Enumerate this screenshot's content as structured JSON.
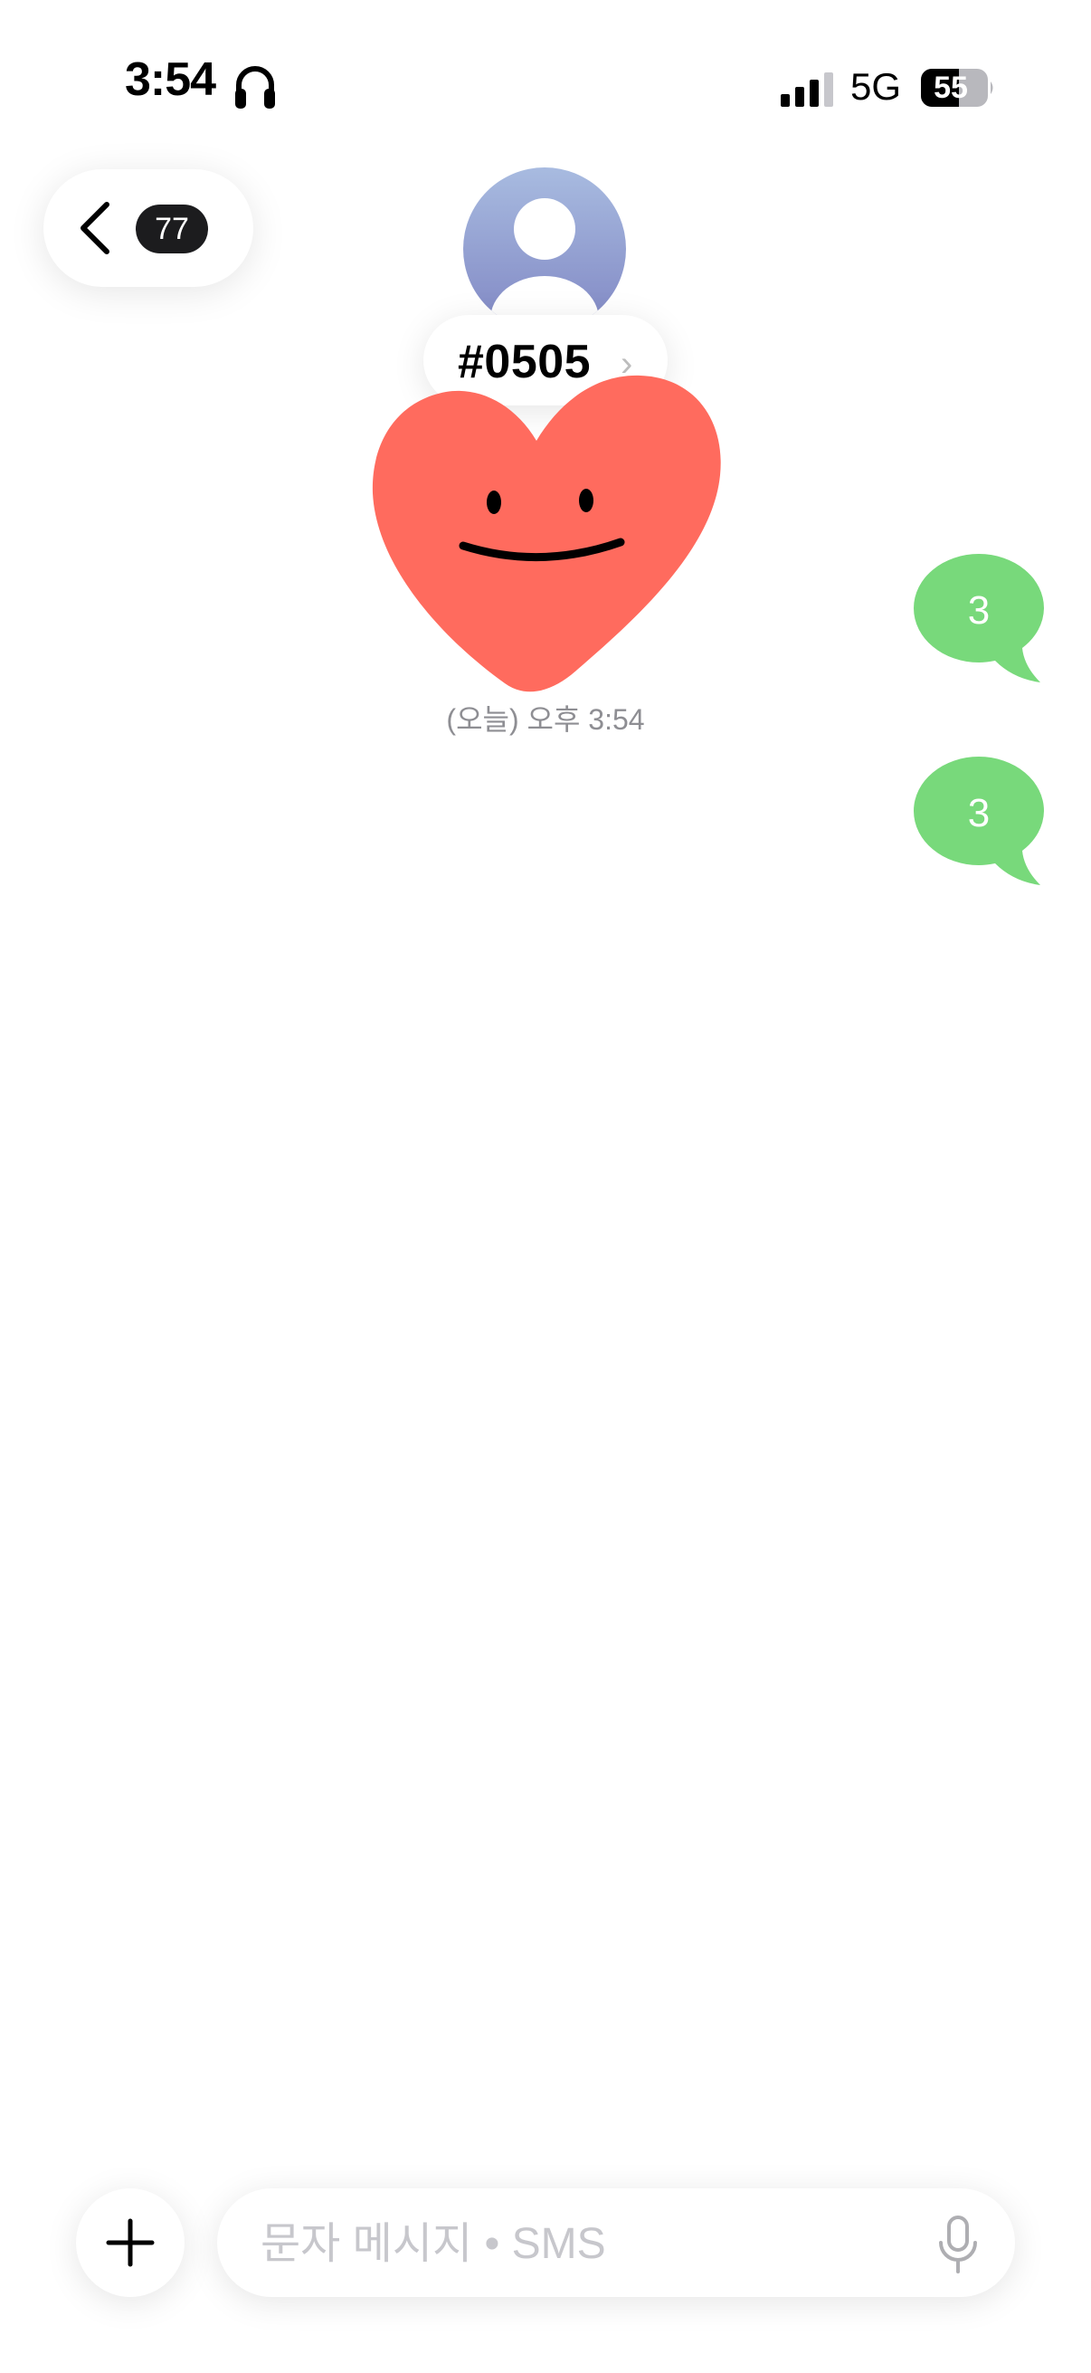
{
  "status_bar": {
    "time": "3:54",
    "network": "5G",
    "battery": "55",
    "icons": [
      "headphones-icon",
      "signal-icon",
      "battery-icon"
    ]
  },
  "nav": {
    "unread_count": "77",
    "icon": "chevron-left-icon"
  },
  "contact": {
    "name": "#0505",
    "chevron": "›",
    "avatar_icon": "person-icon"
  },
  "conversation": {
    "timestamp": "(오늘) 오후 3:54",
    "messages": [
      {
        "text": "3",
        "sender": "me"
      },
      {
        "text": "3",
        "sender": "me"
      }
    ],
    "sticker": "smiling-heart-sticker"
  },
  "composer": {
    "placeholder": "문자 메시지 • SMS",
    "plus_icon": "plus-icon",
    "mic_icon": "microphone-icon"
  },
  "colors": {
    "bubble_green": "#78d97b",
    "heart_red": "#ff6b5e",
    "avatar_top": "#a8bbe0",
    "avatar_bottom": "#8188c4"
  }
}
